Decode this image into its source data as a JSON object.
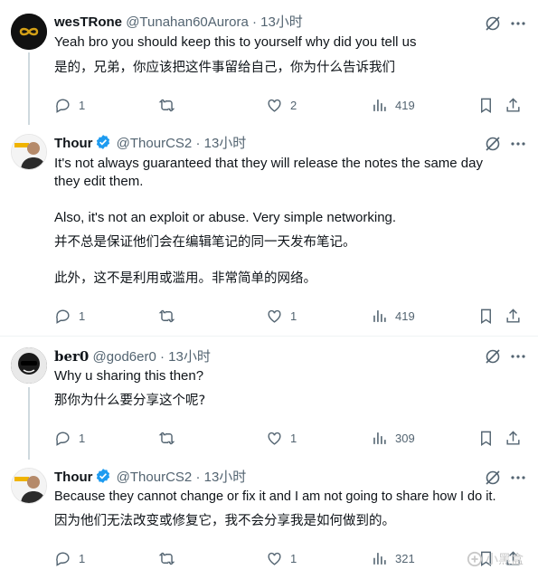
{
  "tweets": [
    {
      "name": "wesTRone",
      "handle": "@Tunahan60Aurora",
      "time": "13小时",
      "verified": false,
      "lines": [
        "Yeah bro you should keep this to yourself why did you tell us",
        "",
        "是的，兄弟，你应该把这件事留给自己，你为什么告诉我们"
      ],
      "replies": "1",
      "retweets": "",
      "likes": "2",
      "views": "419"
    },
    {
      "name": "Thour",
      "handle": "@ThourCS2",
      "time": "13小时",
      "verified": true,
      "lines": [
        "It's not always guaranteed that they will release the notes the same day",
        "they edit them.",
        "Also, it's not an exploit or abuse. Very simple networking.",
        "并不总是保证他们会在编辑笔记的同一天发布笔记。",
        "此外，这不是利用或滥用。非常简单的网络。"
      ],
      "replies": "1",
      "retweets": "",
      "likes": "1",
      "views": "419"
    },
    {
      "name": "𝐛𝐞𝐫𝟎",
      "handle": "@god6er0",
      "time": "13小时",
      "verified": false,
      "lines": [
        "Why u sharing this then?",
        "那你为什么要分享这个呢?"
      ],
      "replies": "1",
      "retweets": "",
      "likes": "1",
      "views": "309"
    },
    {
      "name": "Thour",
      "handle": "@ThourCS2",
      "time": "13小时",
      "verified": true,
      "lines": [
        "Because they cannot change or fix it and I am not going to share how I do it.",
        "因为他们无法改变或修复它，我不会分享我是如何做到的。"
      ],
      "replies": "1",
      "retweets": "",
      "likes": "1",
      "views": "321"
    }
  ],
  "watermark": "小黑盒",
  "colors": {
    "text": "#0f1419",
    "secondary": "#536471",
    "verified": "#1d9bf0",
    "divider": "#eff3f4",
    "thread": "#cfd9de"
  }
}
